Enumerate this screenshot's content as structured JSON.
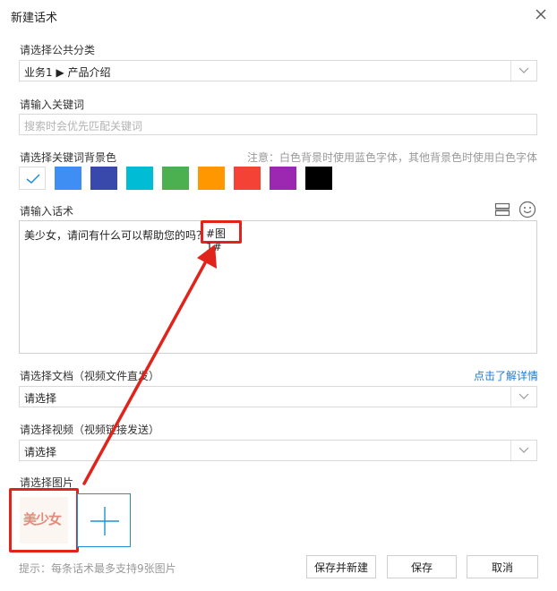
{
  "window": {
    "title": "新建话术"
  },
  "category": {
    "label": "请选择公共分类",
    "value": "业务1 ▶ 产品介绍"
  },
  "keyword": {
    "label": "请输入关键词",
    "placeholder": "搜索时会优先匹配关键词"
  },
  "bgcolor": {
    "label": "请选择关键词背景色",
    "note": "注意：白色背景时使用蓝色字体，其他背景色时使用白色字体",
    "swatches": [
      "#ffffff",
      "#3f8ef3",
      "#3949ab",
      "#00bcd4",
      "#4caf50",
      "#ff9800",
      "#f44336",
      "#9c27b0",
      "#000000"
    ],
    "selected_index": 0
  },
  "script": {
    "label": "请输入话术",
    "text": "美少女，请问有什么可以帮助您的吗？",
    "tag": "#图1#"
  },
  "document": {
    "label": "请选择文档（视频文件直发）",
    "link": "点击了解详情",
    "value": "请选择"
  },
  "video": {
    "label": "请选择视频（视频链接发送）",
    "value": "请选择"
  },
  "image": {
    "label": "请选择图片",
    "thumb_text": "美少女"
  },
  "footer": {
    "hint": "提示：每条话术最多支持9张图片",
    "save_new": "保存并新建",
    "save": "保存",
    "cancel": "取消"
  },
  "colors": {
    "annotation": "#e0241b",
    "link": "#1e7bd1",
    "accent": "#1e90d6"
  }
}
